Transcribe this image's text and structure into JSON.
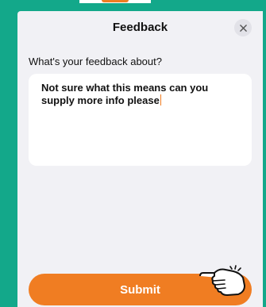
{
  "sheet": {
    "title": "Feedback",
    "question": "What's your feedback about?",
    "feedback_text": "Not sure what this means can you supply more info please",
    "submit_label": "Submit"
  },
  "colors": {
    "background": "#13a88a",
    "sheet": "#f1f1f5",
    "accent": "#f07d22",
    "text": "#111111"
  },
  "icons": {
    "close": "close-icon",
    "pointer": "pointing-hand-icon"
  }
}
